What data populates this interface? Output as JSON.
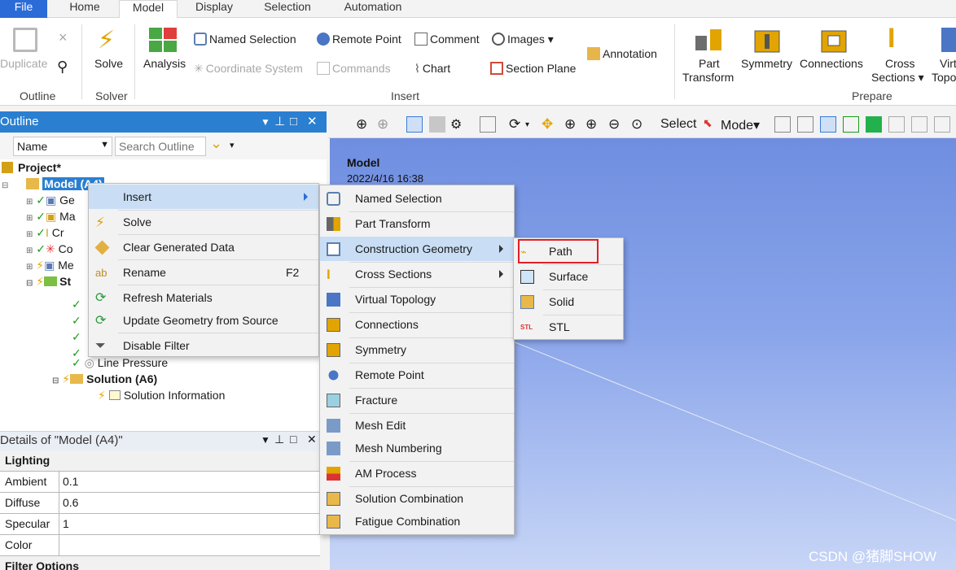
{
  "tabs": [
    {
      "label": "File"
    },
    {
      "label": "Home"
    },
    {
      "label": "Model"
    },
    {
      "label": "Display"
    },
    {
      "label": "Selection"
    },
    {
      "label": "Automation"
    }
  ],
  "ribbon": {
    "duplicate": "Duplicate",
    "outline_group": "Outline",
    "solve": "Solve",
    "solver_group": "Solver",
    "analysis": "Analysis",
    "named_selection": "Named Selection",
    "remote_point": "Remote Point",
    "comment": "Comment",
    "images": "Images",
    "coordinate_system": "Coordinate System",
    "commands": "Commands",
    "chart": "Chart",
    "section_plane": "Section Plane",
    "annotation": "Annotation",
    "insert_group": "Insert",
    "part_transform_1": "Part",
    "part_transform_2": "Transform",
    "symmetry": "Symmetry",
    "connections": "Connections",
    "cross_1": "Cross",
    "cross_2": "Sections",
    "virt_1": "Virt",
    "virt_2": "Topo",
    "prepare_group": "Prepare"
  },
  "outline": {
    "title": "Outline",
    "name_filter": "Name",
    "search_placeholder": "Search Outline",
    "project": "Project*",
    "model": "Model (A4)",
    "items": [
      "Ge",
      "Ma",
      "Cr",
      "Co",
      "Me",
      "St"
    ],
    "line_pressure": "Line Pressure",
    "solution": "Solution (A6)",
    "solution_info": "Solution Information"
  },
  "details": {
    "title": "Details of \"Model (A4)\"",
    "rows": [
      {
        "key": "Lighting",
        "value": ""
      },
      {
        "key": "Ambient",
        "value": "0.1"
      },
      {
        "key": "Diffuse",
        "value": "0.6"
      },
      {
        "key": "Specular",
        "value": "1"
      },
      {
        "key": "Color",
        "value": ""
      },
      {
        "key": "Filter Options",
        "value": ""
      }
    ]
  },
  "graphics": {
    "select": "Select",
    "mode": "Mode",
    "model_label": "Model",
    "timestamp": "2022/4/16 16:38",
    "watermark": "CSDN @猪脚SHOW"
  },
  "menu1": {
    "insert": "Insert",
    "solve": "Solve",
    "clear": "Clear Generated Data",
    "rename": "Rename",
    "rename_shortcut": "F2",
    "refresh": "Refresh Materials",
    "update": "Update Geometry from Source",
    "disable_filter": "Disable Filter"
  },
  "menu2": [
    "Named Selection",
    "Part Transform",
    "Construction Geometry",
    "Cross Sections",
    "Virtual Topology",
    "Connections",
    "Symmetry",
    "Remote Point",
    "Fracture",
    "Mesh Edit",
    "Mesh Numbering",
    "AM Process",
    "Solution Combination",
    "Fatigue Combination"
  ],
  "menu3": [
    "Path",
    "Surface",
    "Solid",
    "STL"
  ],
  "colors": {
    "accent": "#2a7fd1",
    "highlight": "#c9def5",
    "callout": "#e0202a"
  }
}
